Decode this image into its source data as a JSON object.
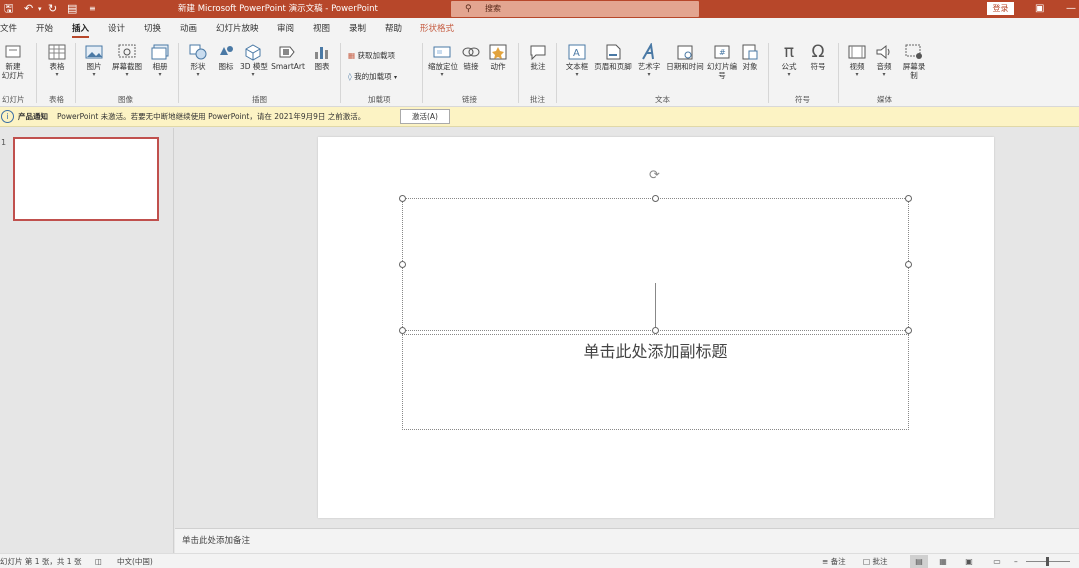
{
  "titlebar": {
    "doc_title": "新建 Microsoft PowerPoint 演示文稿  -  PowerPoint",
    "search_placeholder": "搜索",
    "login_label": "登录",
    "save_icon": "save-icon",
    "undo_icon": "undo-icon",
    "redo_icon": "redo-icon",
    "present_icon": "present-icon",
    "customize_icon": "customize-icon",
    "accent_color": "#b7472a"
  },
  "tabs": [
    "文件",
    "开始",
    "插入",
    "设计",
    "切换",
    "动画",
    "幻灯片放映",
    "审阅",
    "视图",
    "录制",
    "帮助",
    "形状格式"
  ],
  "active_tab": "插入",
  "ribbon": {
    "groups": {
      "slides": "幻灯片",
      "tables": "表格",
      "images": "图像",
      "illustrations": "插图",
      "addins": "加载项",
      "links": "链接",
      "comments": "批注",
      "text": "文本",
      "symbols": "符号",
      "media": "媒体"
    },
    "items": {
      "new_slide": "新建\n幻灯片",
      "table": "表格",
      "picture": "图片",
      "screenshot": "屏幕截图",
      "album": "相册",
      "shapes": "形状",
      "icons": "图标",
      "model3d": "3D 模型",
      "smartart": "SmartArt",
      "chart": "图表",
      "get_addins": "获取加载项",
      "my_addins": "我的加载项",
      "zoom": "缩放定位",
      "link": "链接",
      "action": "动作",
      "comment": "批注",
      "textbox": "文本框",
      "header_footer": "页眉和页脚",
      "wordart": "艺术字",
      "datetime": "日期和时间",
      "slide_number": "幻灯片编号",
      "object": "对象",
      "equation": "公式",
      "symbol": "符号",
      "video": "视频",
      "audio": "音频",
      "screen_record": "屏幕录制"
    }
  },
  "notification": {
    "title": "产品通知",
    "message": "PowerPoint 未激活。若要无中断地继续使用 PowerPoint，请在 2021年9月9日 之前激活。",
    "button": "激活(A)"
  },
  "thumbnails": {
    "number": "1"
  },
  "slide": {
    "subtitle_placeholder": "单击此处添加副标题"
  },
  "notes": {
    "placeholder": "单击此处添加备注"
  },
  "status": {
    "slide_info": "幻灯片 第 1 张，共 1 张",
    "language": "中文(中国)",
    "notes_btn": "备注",
    "comments_btn": "批注"
  }
}
